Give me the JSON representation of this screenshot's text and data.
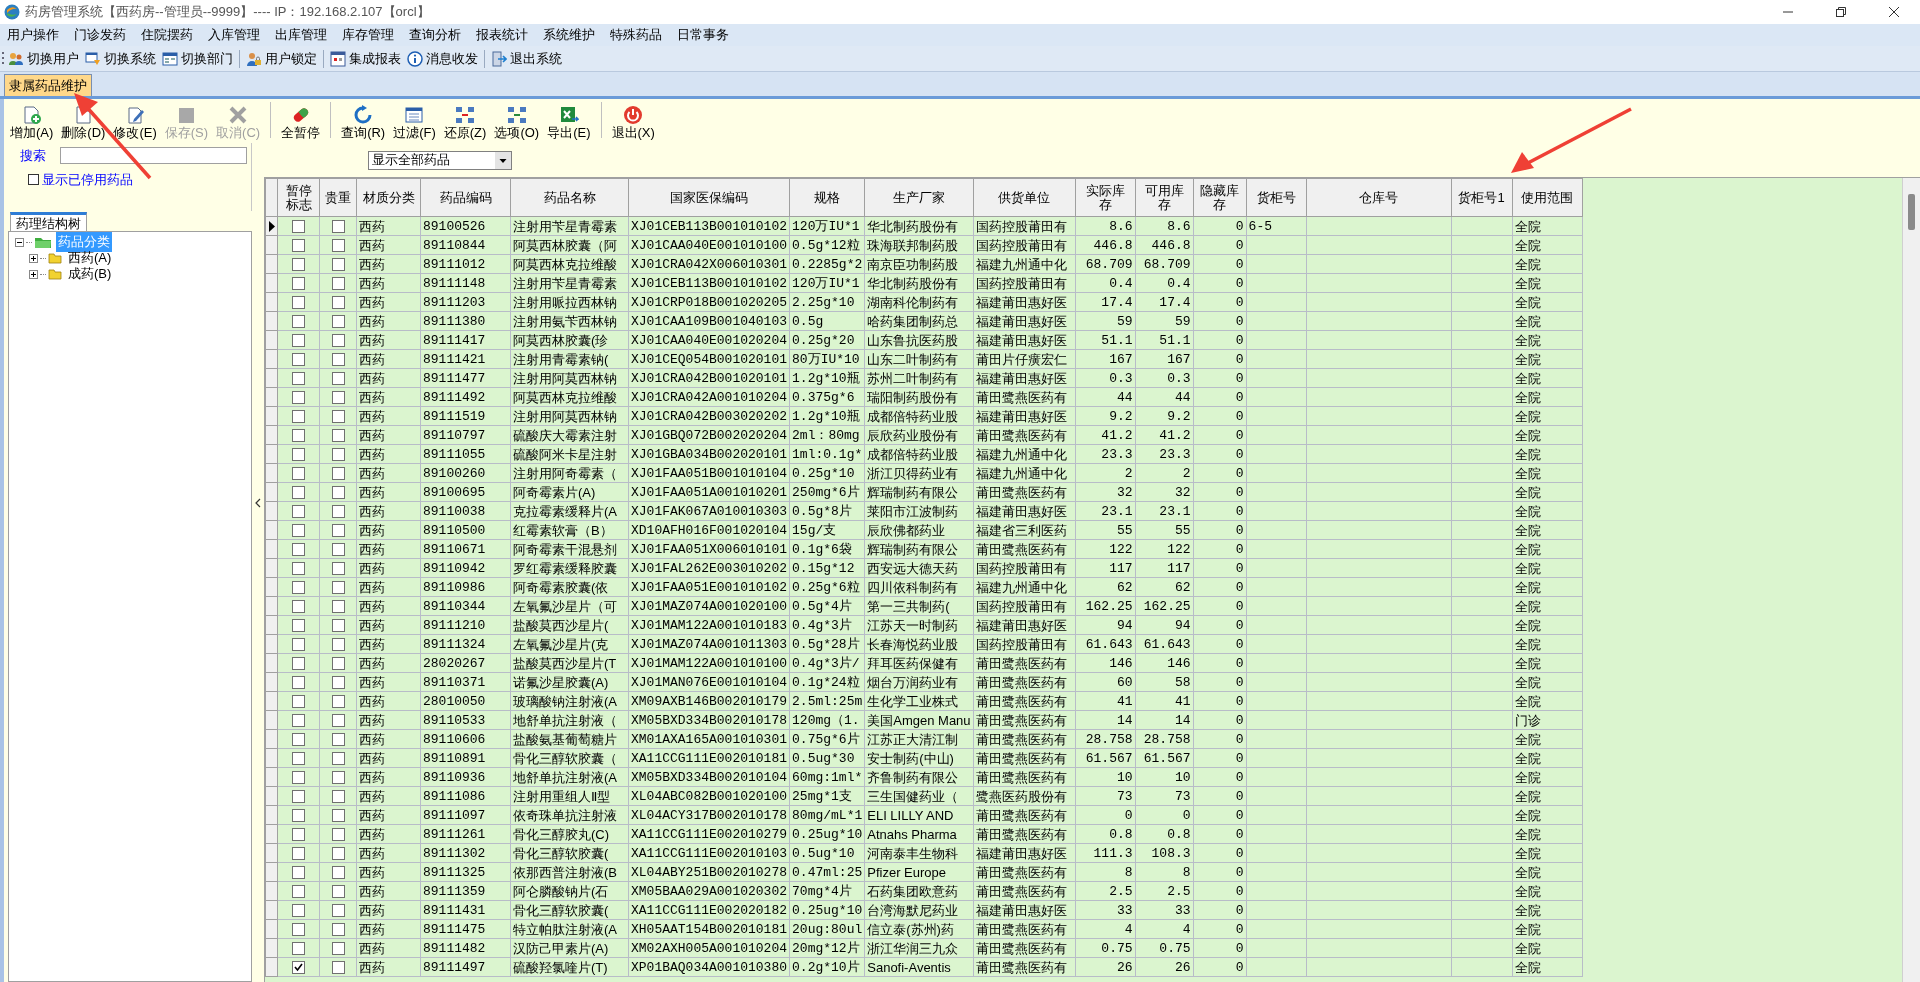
{
  "window": {
    "title": "药房管理系统【西药房--管理员--9999】---- IP：192.168.2.107【orcl】"
  },
  "menu": [
    "用户操作",
    "门诊发药",
    "住院摆药",
    "入库管理",
    "出库管理",
    "库存管理",
    "查询分析",
    "报表统计",
    "系统维护",
    "特殊药品",
    "日常事务"
  ],
  "main_toolbar": [
    {
      "label": "切换用户"
    },
    {
      "label": "切换系统"
    },
    {
      "label": "切换部门"
    },
    {
      "label": "用户锁定"
    },
    {
      "label": "集成报表"
    },
    {
      "label": "消息收发"
    },
    {
      "label": "退出系统"
    }
  ],
  "tabs": [
    {
      "label": "隶属药品维护",
      "selected": true
    }
  ],
  "toolbar": [
    {
      "label": "增加(A)",
      "disabled": false
    },
    {
      "label": "删除(D)",
      "disabled": false
    },
    {
      "label": "修改(E)",
      "disabled": false
    },
    {
      "label": "保存(S)",
      "disabled": true
    },
    {
      "label": "取消(C)",
      "disabled": true
    },
    {
      "label": "全暂停",
      "disabled": false
    },
    {
      "label": "查询(R)",
      "disabled": false
    },
    {
      "label": "过滤(F)",
      "disabled": false
    },
    {
      "label": "还原(Z)",
      "disabled": false
    },
    {
      "label": "选项(O)",
      "disabled": false
    },
    {
      "label": "导出(E)",
      "disabled": false
    },
    {
      "label": "退出(X)",
      "disabled": false
    }
  ],
  "search": {
    "label": "搜索"
  },
  "show_disabled": {
    "label": "显示已停用药品",
    "checked": false
  },
  "filter": {
    "value": "显示全部药品"
  },
  "tree_tab": "药理结构树",
  "tree": {
    "label": "药品分类",
    "selected": true,
    "expanded": true,
    "children": [
      {
        "label": "西药(A)",
        "selected": false,
        "expanded": false
      },
      {
        "label": "成药(B)",
        "selected": false,
        "expanded": false
      }
    ]
  },
  "table": {
    "columns": [
      {
        "label": "暂停标志",
        "kind": "check"
      },
      {
        "label": "贵重",
        "kind": "check"
      },
      {
        "label": "材质分类",
        "kind": "text"
      },
      {
        "label": "药品编码",
        "kind": "text"
      },
      {
        "label": "药品名称",
        "kind": "text"
      },
      {
        "label": "国家医保编码",
        "kind": "text"
      },
      {
        "label": "规格",
        "kind": "text"
      },
      {
        "label": "生产厂家",
        "kind": "text"
      },
      {
        "label": "供货单位",
        "kind": "text"
      },
      {
        "label": "实际库存",
        "kind": "number"
      },
      {
        "label": "可用库存",
        "kind": "number"
      },
      {
        "label": "隐藏库存",
        "kind": "number"
      },
      {
        "label": "货柜号",
        "kind": "text"
      },
      {
        "label": "仓库号",
        "kind": "text"
      },
      {
        "label": "货柜号1",
        "kind": "text"
      },
      {
        "label": "使用范围",
        "kind": "text"
      }
    ],
    "rows": [
      {
        "selected": true,
        "paused": false,
        "precious": false,
        "category": "西药",
        "code": "89100526",
        "name": "注射用苄星青霉素",
        "insurance_code": "XJ01CEB113B001010102",
        "spec": "120万IU*1",
        "manufacturer": "华北制药股份有",
        "supplier": "国药控股莆田有",
        "actual_stock": "8.6",
        "available_stock": "8.6",
        "hidden_stock": "0",
        "cabinet": "6-5",
        "scope": "全院"
      },
      {
        "selected": false,
        "paused": false,
        "precious": false,
        "category": "西药",
        "code": "89110844",
        "name": "阿莫西林胶囊（阿",
        "insurance_code": "XJ01CAA040E001010100",
        "spec": "0.5g*12粒",
        "manufacturer": "珠海联邦制药股",
        "supplier": "国药控股莆田有",
        "actual_stock": "446.8",
        "available_stock": "446.8",
        "hidden_stock": "0",
        "scope": "全院"
      },
      {
        "selected": false,
        "paused": false,
        "precious": false,
        "category": "西药",
        "code": "89111012",
        "name": "阿莫西林克拉维酸",
        "insurance_code": "XJ01CRA042X006010301",
        "spec": "0.2285g*2",
        "manufacturer": "南京臣功制药股",
        "supplier": "福建九州通中化",
        "actual_stock": "68.709",
        "available_stock": "68.709",
        "hidden_stock": "0",
        "scope": "全院"
      },
      {
        "selected": false,
        "paused": false,
        "precious": false,
        "category": "西药",
        "code": "89111148",
        "name": "注射用苄星青霉素",
        "insurance_code": "XJ01CEB113B001010102",
        "spec": "120万IU*1",
        "manufacturer": "华北制药股份有",
        "supplier": "国药控股莆田有",
        "actual_stock": "0.4",
        "available_stock": "0.4",
        "hidden_stock": "0",
        "scope": "全院"
      },
      {
        "selected": false,
        "paused": false,
        "precious": false,
        "category": "西药",
        "code": "89111203",
        "name": "注射用哌拉西林钠",
        "insurance_code": "XJ01CRP018B001020205",
        "spec": "2.25g*10",
        "manufacturer": "湖南科伦制药有",
        "supplier": "福建莆田惠好医",
        "actual_stock": "17.4",
        "available_stock": "17.4",
        "hidden_stock": "0",
        "scope": "全院"
      },
      {
        "selected": false,
        "paused": false,
        "precious": false,
        "category": "西药",
        "code": "89111380",
        "name": "注射用氨苄西林钠",
        "insurance_code": "XJ01CAA109B001040103",
        "spec": "0.5g",
        "manufacturer": "哈药集团制药总",
        "supplier": "福建莆田惠好医",
        "actual_stock": "59",
        "available_stock": "59",
        "hidden_stock": "0",
        "scope": "全院"
      },
      {
        "selected": false,
        "paused": false,
        "precious": false,
        "category": "西药",
        "code": "89111417",
        "name": "阿莫西林胶囊(珍",
        "insurance_code": "XJ01CAA040E001020204",
        "spec": "0.25g*20",
        "manufacturer": "山东鲁抗医药股",
        "supplier": "福建莆田惠好医",
        "actual_stock": "51.1",
        "available_stock": "51.1",
        "hidden_stock": "0",
        "scope": "全院"
      },
      {
        "selected": false,
        "paused": false,
        "precious": false,
        "category": "西药",
        "code": "89111421",
        "name": "注射用青霉素钠(",
        "insurance_code": "XJ01CEQ054B001020101",
        "spec": "80万IU*10",
        "manufacturer": "山东二叶制药有",
        "supplier": "莆田片仔癀宏仁",
        "actual_stock": "167",
        "available_stock": "167",
        "hidden_stock": "0",
        "scope": "全院"
      },
      {
        "selected": false,
        "paused": false,
        "precious": false,
        "category": "西药",
        "code": "89111477",
        "name": "注射用阿莫西林钠",
        "insurance_code": "XJ01CRA042B001020101",
        "spec": "1.2g*10瓶",
        "manufacturer": "苏州二叶制药有",
        "supplier": "福建莆田惠好医",
        "actual_stock": "0.3",
        "available_stock": "0.3",
        "hidden_stock": "0",
        "scope": "全院"
      },
      {
        "selected": false,
        "paused": false,
        "precious": false,
        "category": "西药",
        "code": "89111492",
        "name": "阿莫西林克拉维酸",
        "insurance_code": "XJ01CRA042A001010204",
        "spec": "0.375g*6",
        "manufacturer": "瑞阳制药股份有",
        "supplier": "莆田鹭燕医药有",
        "actual_stock": "44",
        "available_stock": "44",
        "hidden_stock": "0",
        "scope": "全院"
      },
      {
        "selected": false,
        "paused": false,
        "precious": false,
        "category": "西药",
        "code": "89111519",
        "name": "注射用阿莫西林钠",
        "insurance_code": "XJ01CRA042B003020202",
        "spec": "1.2g*10瓶",
        "manufacturer": "成都倍特药业股",
        "supplier": "福建莆田惠好医",
        "actual_stock": "9.2",
        "available_stock": "9.2",
        "hidden_stock": "0",
        "scope": "全院"
      },
      {
        "selected": false,
        "paused": false,
        "precious": false,
        "category": "西药",
        "code": "89110797",
        "name": "硫酸庆大霉素注射",
        "insurance_code": "XJ01GBQ072B002020204",
        "spec": "2ml：80mg",
        "manufacturer": "辰欣药业股份有",
        "supplier": "莆田鹭燕医药有",
        "actual_stock": "41.2",
        "available_stock": "41.2",
        "hidden_stock": "0",
        "scope": "全院"
      },
      {
        "selected": false,
        "paused": false,
        "precious": false,
        "category": "西药",
        "code": "89111055",
        "name": "硫酸阿米卡星注射",
        "insurance_code": "XJ01GBA034B002020101",
        "spec": "1ml:0.1g*",
        "manufacturer": "成都倍特药业股",
        "supplier": "福建九州通中化",
        "actual_stock": "23.3",
        "available_stock": "23.3",
        "hidden_stock": "0",
        "scope": "全院"
      },
      {
        "selected": false,
        "paused": false,
        "precious": false,
        "category": "西药",
        "code": "89100260",
        "name": "注射用阿奇霉素（",
        "insurance_code": "XJ01FAA051B001010104",
        "spec": "0.25g*10",
        "manufacturer": "浙江贝得药业有",
        "supplier": "福建九州通中化",
        "actual_stock": "2",
        "available_stock": "2",
        "hidden_stock": "0",
        "scope": "全院"
      },
      {
        "selected": false,
        "paused": false,
        "precious": false,
        "category": "西药",
        "code": "89100695",
        "name": "阿奇霉素片(A)",
        "insurance_code": "XJ01FAA051A001010201",
        "spec": "250mg*6片",
        "manufacturer": "辉瑞制药有限公",
        "supplier": "莆田鹭燕医药有",
        "actual_stock": "32",
        "available_stock": "32",
        "hidden_stock": "0",
        "scope": "全院"
      },
      {
        "selected": false,
        "paused": false,
        "precious": false,
        "category": "西药",
        "code": "89110038",
        "name": "克拉霉素缓释片(A",
        "insurance_code": "XJ01FAK067A010010303",
        "spec": "0.5g*8片",
        "manufacturer": "莱阳市江波制药",
        "supplier": "福建莆田惠好医",
        "actual_stock": "23.1",
        "available_stock": "23.1",
        "hidden_stock": "0",
        "scope": "全院"
      },
      {
        "selected": false,
        "paused": false,
        "precious": false,
        "category": "西药",
        "code": "89110500",
        "name": "红霉素软膏（B）",
        "insurance_code": "XD10AFH016F001020104",
        "spec": "15g/支",
        "manufacturer": "辰欣佛都药业",
        "supplier": "福建省三利医药",
        "actual_stock": "55",
        "available_stock": "55",
        "hidden_stock": "0",
        "scope": "全院"
      },
      {
        "selected": false,
        "paused": false,
        "precious": false,
        "category": "西药",
        "code": "89110671",
        "name": "阿奇霉素干混悬剂",
        "insurance_code": "XJ01FAA051X006010101",
        "spec": "0.1g*6袋",
        "manufacturer": "辉瑞制药有限公",
        "supplier": "莆田鹭燕医药有",
        "actual_stock": "122",
        "available_stock": "122",
        "hidden_stock": "0",
        "scope": "全院"
      },
      {
        "selected": false,
        "paused": false,
        "precious": false,
        "category": "西药",
        "code": "89110942",
        "name": "罗红霉素缓释胶囊",
        "insurance_code": "XJ01FAL262E003010202",
        "spec": "0.15g*12",
        "manufacturer": "西安远大德天药",
        "supplier": "国药控股莆田有",
        "actual_stock": "117",
        "available_stock": "117",
        "hidden_stock": "0",
        "scope": "全院"
      },
      {
        "selected": false,
        "paused": false,
        "precious": false,
        "category": "西药",
        "code": "89110986",
        "name": "阿奇霉素胶囊(依",
        "insurance_code": "XJ01FAA051E001010102",
        "spec": "0.25g*6粒",
        "manufacturer": "四川依科制药有",
        "supplier": "福建九州通中化",
        "actual_stock": "62",
        "available_stock": "62",
        "hidden_stock": "0",
        "scope": "全院"
      },
      {
        "selected": false,
        "paused": false,
        "precious": false,
        "category": "西药",
        "code": "89110344",
        "name": "左氧氟沙星片（可",
        "insurance_code": "XJ01MAZ074A001020100",
        "spec": "0.5g*4片",
        "manufacturer": "第一三共制药(",
        "supplier": "国药控股莆田有",
        "actual_stock": "162.25",
        "available_stock": "162.25",
        "hidden_stock": "0",
        "scope": "全院"
      },
      {
        "selected": false,
        "paused": false,
        "precious": false,
        "category": "西药",
        "code": "89111210",
        "name": "盐酸莫西沙星片(",
        "insurance_code": "XJ01MAM122A001010183",
        "spec": "0.4g*3片",
        "manufacturer": "江苏天一时制药",
        "supplier": "福建莆田惠好医",
        "actual_stock": "94",
        "available_stock": "94",
        "hidden_stock": "0",
        "scope": "全院"
      },
      {
        "selected": false,
        "paused": false,
        "precious": false,
        "category": "西药",
        "code": "89111324",
        "name": "左氧氟沙星片(克",
        "insurance_code": "XJ01MAZ074A001011303",
        "spec": "0.5g*28片",
        "manufacturer": "长春海悦药业股",
        "supplier": "国药控股莆田有",
        "actual_stock": "61.643",
        "available_stock": "61.643",
        "hidden_stock": "0",
        "scope": "全院"
      },
      {
        "selected": false,
        "paused": false,
        "precious": false,
        "category": "西药",
        "code": "28020267",
        "name": "盐酸莫西沙星片(T",
        "insurance_code": "XJ01MAM122A001010100",
        "spec": "0.4g*3片/",
        "manufacturer": "拜耳医药保健有",
        "supplier": "莆田鹭燕医药有",
        "actual_stock": "146",
        "available_stock": "146",
        "hidden_stock": "0",
        "scope": "全院"
      },
      {
        "selected": false,
        "paused": false,
        "precious": false,
        "category": "西药",
        "code": "89110371",
        "name": "诺氟沙星胶囊(A)",
        "insurance_code": "XJ01MAN076E001010104",
        "spec": "0.1g*24粒",
        "manufacturer": "烟台万润药业有",
        "supplier": "莆田鹭燕医药有",
        "actual_stock": "60",
        "available_stock": "58",
        "hidden_stock": "0",
        "scope": "全院"
      },
      {
        "selected": false,
        "paused": false,
        "precious": false,
        "category": "西药",
        "code": "28010050",
        "name": "玻璃酸钠注射液(A",
        "insurance_code": "XM09AXB146B002010179",
        "spec": "2.5ml:25m",
        "manufacturer": "生化学工业株式",
        "supplier": "莆田鹭燕医药有",
        "actual_stock": "41",
        "available_stock": "41",
        "hidden_stock": "0",
        "scope": "全院"
      },
      {
        "selected": false,
        "paused": false,
        "precious": false,
        "category": "西药",
        "code": "89110533",
        "name": "地舒单抗注射液（",
        "insurance_code": "XM05BXD334B002010178",
        "spec": "120mg（1.",
        "manufacturer": "美国Amgen Manu",
        "supplier": "莆田鹭燕医药有",
        "actual_stock": "14",
        "available_stock": "14",
        "hidden_stock": "0",
        "scope": "门诊"
      },
      {
        "selected": false,
        "paused": false,
        "precious": false,
        "category": "西药",
        "code": "89110606",
        "name": "盐酸氨基葡萄糖片",
        "insurance_code": "XM01AXA165A001010301",
        "spec": "0.75g*6片",
        "manufacturer": "江苏正大清江制",
        "supplier": "莆田鹭燕医药有",
        "actual_stock": "28.758",
        "available_stock": "28.758",
        "hidden_stock": "0",
        "scope": "全院"
      },
      {
        "selected": false,
        "paused": false,
        "precious": false,
        "category": "西药",
        "code": "89110891",
        "name": "骨化三醇软胶囊（",
        "insurance_code": "XA11CCG111E002010181",
        "spec": "0.5ug*30",
        "manufacturer": "安士制药(中山)",
        "supplier": "莆田鹭燕医药有",
        "actual_stock": "61.567",
        "available_stock": "61.567",
        "hidden_stock": "0",
        "scope": "全院"
      },
      {
        "selected": false,
        "paused": false,
        "precious": false,
        "category": "西药",
        "code": "89110936",
        "name": "地舒单抗注射液(A",
        "insurance_code": "XM05BXD334B002010104",
        "spec": "60mg:1ml*",
        "manufacturer": "齐鲁制药有限公",
        "supplier": "莆田鹭燕医药有",
        "actual_stock": "10",
        "available_stock": "10",
        "hidden_stock": "0",
        "scope": "全院"
      },
      {
        "selected": false,
        "paused": false,
        "precious": false,
        "category": "西药",
        "code": "89111086",
        "name": "注射用重组人Ⅱ型",
        "insurance_code": "XL04ABC082B001020100",
        "spec": "25mg*1支",
        "manufacturer": "三生国健药业（",
        "supplier": "鹭燕医药股份有",
        "actual_stock": "73",
        "available_stock": "73",
        "hidden_stock": "0",
        "scope": "全院"
      },
      {
        "selected": false,
        "paused": false,
        "precious": false,
        "category": "西药",
        "code": "89111097",
        "name": "依奇珠单抗注射液",
        "insurance_code": "XL04ACY317B002010178",
        "spec": "80mg/mL*1",
        "manufacturer": "ELI LILLY AND",
        "supplier": "莆田鹭燕医药有",
        "actual_stock": "0",
        "available_stock": "0",
        "hidden_stock": "0",
        "scope": "全院"
      },
      {
        "selected": false,
        "paused": false,
        "precious": false,
        "category": "西药",
        "code": "89111261",
        "name": "骨化三醇胶丸(C)",
        "insurance_code": "XA11CCG111E002010279",
        "spec": "0.25ug*10",
        "manufacturer": "Atnahs Pharma",
        "supplier": "莆田鹭燕医药有",
        "actual_stock": "0.8",
        "available_stock": "0.8",
        "hidden_stock": "0",
        "scope": "全院"
      },
      {
        "selected": false,
        "paused": false,
        "precious": false,
        "category": "西药",
        "code": "89111302",
        "name": "骨化三醇软胶囊(",
        "insurance_code": "XA11CCG111E002010103",
        "spec": "0.5ug*10",
        "manufacturer": "河南泰丰生物科",
        "supplier": "福建莆田惠好医",
        "actual_stock": "111.3",
        "available_stock": "108.3",
        "hidden_stock": "0",
        "scope": "全院"
      },
      {
        "selected": false,
        "paused": false,
        "precious": false,
        "category": "西药",
        "code": "89111325",
        "name": "依那西普注射液(B",
        "insurance_code": "XL04ABY251B002010278",
        "spec": "0.47ml:25",
        "manufacturer": "Pfizer Europe",
        "supplier": "莆田鹭燕医药有",
        "actual_stock": "8",
        "available_stock": "8",
        "hidden_stock": "0",
        "scope": "全院"
      },
      {
        "selected": false,
        "paused": false,
        "precious": false,
        "category": "西药",
        "code": "89111359",
        "name": "阿仑膦酸钠片(石",
        "insurance_code": "XM05BAA029A001020302",
        "spec": "70mg*4片",
        "manufacturer": "石药集团欧意药",
        "supplier": "莆田鹭燕医药有",
        "actual_stock": "2.5",
        "available_stock": "2.5",
        "hidden_stock": "0",
        "scope": "全院"
      },
      {
        "selected": false,
        "paused": false,
        "precious": false,
        "category": "西药",
        "code": "89111431",
        "name": "骨化三醇软胶囊(",
        "insurance_code": "XA11CCG111E002020182",
        "spec": "0.25ug*10",
        "manufacturer": "台湾海默尼药业",
        "supplier": "福建莆田惠好医",
        "actual_stock": "33",
        "available_stock": "33",
        "hidden_stock": "0",
        "scope": "全院"
      },
      {
        "selected": false,
        "paused": false,
        "precious": false,
        "category": "西药",
        "code": "89111475",
        "name": "特立帕肽注射液(A",
        "insurance_code": "XH05AAT154B002010181",
        "spec": "20ug:80ul",
        "manufacturer": "信立泰(苏州)药",
        "supplier": "莆田鹭燕医药有",
        "actual_stock": "4",
        "available_stock": "4",
        "hidden_stock": "0",
        "scope": "全院"
      },
      {
        "selected": false,
        "paused": false,
        "precious": false,
        "category": "西药",
        "code": "89111482",
        "name": "汉防己甲素片(A)",
        "insurance_code": "XM02AXH005A001010204",
        "spec": "20mg*12片",
        "manufacturer": "浙江华润三九众",
        "supplier": "莆田鹭燕医药有",
        "actual_stock": "0.75",
        "available_stock": "0.75",
        "hidden_stock": "0",
        "scope": "全院"
      },
      {
        "selected": false,
        "paused": true,
        "precious": false,
        "category": "西药",
        "code": "89111497",
        "name": "硫酸羟氯喹片(T)",
        "insurance_code": "XP01BAQ034A001010380",
        "spec": "0.2g*10片",
        "manufacturer": "Sanofi-Aventis",
        "supplier": "莆田鹭燕医药有",
        "actual_stock": "26",
        "available_stock": "26",
        "hidden_stock": "0",
        "scope": "全院"
      }
    ]
  }
}
